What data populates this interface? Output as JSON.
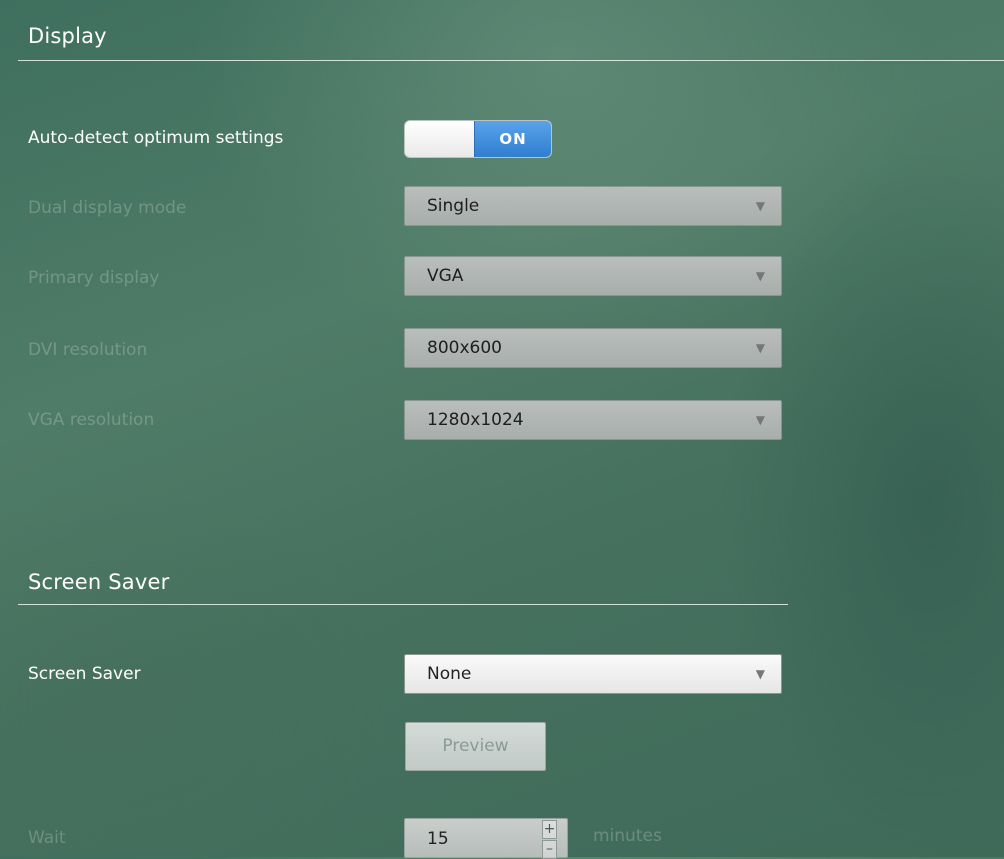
{
  "display": {
    "title": "Display",
    "auto_detect": {
      "label": "Auto-detect optimum settings",
      "state": "ON"
    },
    "dual_display_mode": {
      "label": "Dual display mode",
      "value": "Single"
    },
    "primary_display": {
      "label": "Primary display",
      "value": "VGA"
    },
    "dvi_resolution": {
      "label": "DVI resolution",
      "value": "800x600"
    },
    "vga_resolution": {
      "label": "VGA resolution",
      "value": "1280x1024"
    }
  },
  "screen_saver_section": {
    "title": "Screen Saver",
    "screen_saver": {
      "label": "Screen Saver",
      "value": "None"
    },
    "preview_button": "Preview",
    "wait": {
      "label": "Wait",
      "value": "15",
      "unit": "minutes",
      "increment": "+",
      "decrement": "–"
    }
  },
  "icons": {
    "dropdown_arrow": "▼"
  },
  "colors": {
    "toggle_on": "#2f7fd0",
    "background": "#46715f"
  }
}
